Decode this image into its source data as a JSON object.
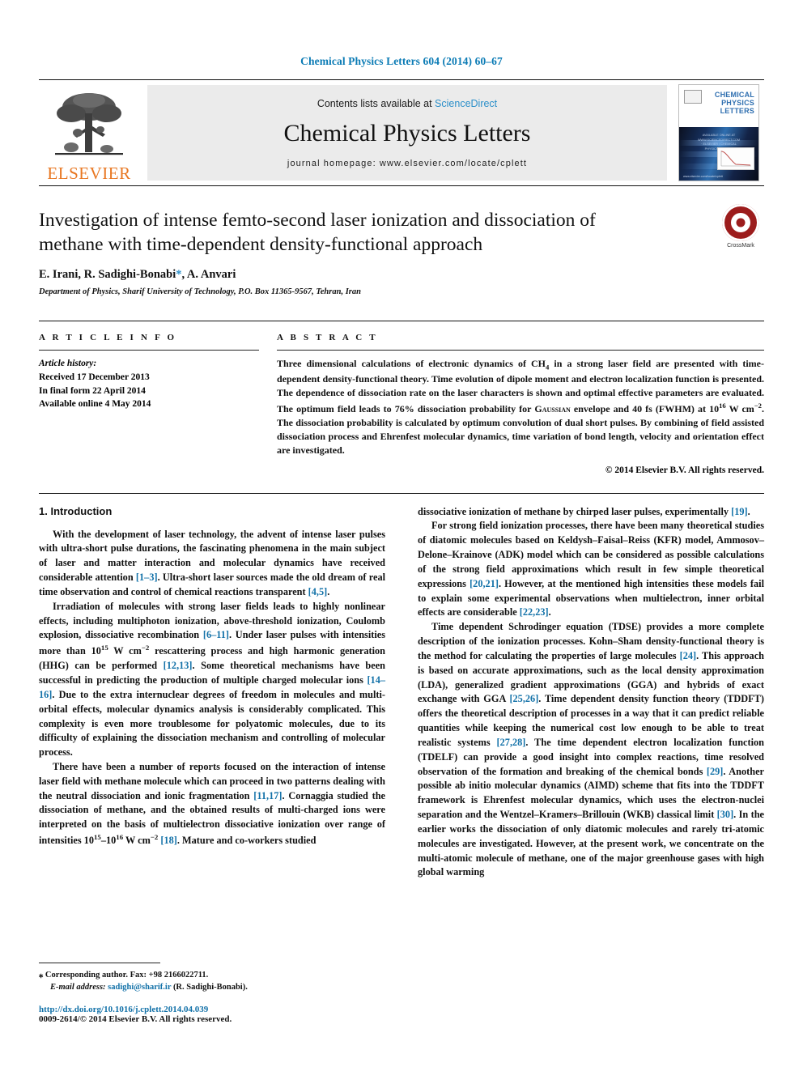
{
  "running_head": "Chemical Physics Letters 604 (2014) 60–67",
  "masthead": {
    "publisher_name": "ELSEVIER",
    "contents_prefix": "Contents lists available at ",
    "contents_link": "ScienceDirect",
    "journal_title": "Chemical Physics Letters",
    "homepage": "journal homepage: www.elsevier.com/locate/cplett",
    "cover": {
      "journal_name_line1": "CHEMICAL",
      "journal_name_line2": "PHYSICS",
      "journal_name_line3": "LETTERS",
      "header_note": "AVAILABLE ONLINE AT WWW.SCIENCEDIRECT.COM\nELSEVIER / CHEMICAL PHYSICS LETTERS",
      "footer_note": "www.elsevier.com/locate/cplett"
    }
  },
  "article": {
    "title": "Investigation of intense femto-second laser ionization and dissociation of methane with time-dependent density-functional approach",
    "authors_part1": "E. Irani, R. Sadighi-Bonabi",
    "authors_star": "*",
    "authors_part2": ", A. Anvari",
    "affiliation": "Department of Physics, Sharif University of Technology, P.O. Box 11365-9567, Tehran, Iran",
    "crossmark_label": "CrossMark"
  },
  "article_info": {
    "heading": "A R T I C L E    I N F O",
    "history_label": "Article history:",
    "history": [
      "Received 17 December 2013",
      "In final form 22 April 2014",
      "Available online 4 May 2014"
    ]
  },
  "abstract": {
    "heading": "A B S T R A C T",
    "segments": [
      {
        "t": "Three dimensional calculations of electronic dynamics of CH"
      },
      {
        "sub": "4"
      },
      {
        "t": " in a strong laser field are presented with time-dependent density-functional theory. Time evolution of dipole moment and electron localization function is presented. The dependence of dissociation rate on the laser characters is shown and optimal effective parameters are evaluated. The optimum field leads to 76% dissociation probability for "
      },
      {
        "smallcaps": "Gaussian"
      },
      {
        "t": " envelope and 40 fs (FWHM) at 10"
      },
      {
        "sup": "16"
      },
      {
        "t": " W cm"
      },
      {
        "sup": "−2"
      },
      {
        "t": ". The dissociation probability is calculated by optimum convolution of dual short pulses. By combining of field assisted dissociation process and Ehrenfest molecular dynamics, time variation of bond length, velocity and orientation effect are investigated."
      }
    ],
    "copyright": "© 2014 Elsevier B.V. All rights reserved."
  },
  "body": {
    "section_heading": "1. Introduction",
    "left_column": [
      [
        {
          "t": "With the development of laser technology, the advent of intense laser pulses with ultra-short pulse durations, the fascinating phenomena in the main subject of laser and matter interaction and molecular dynamics have received considerable attention "
        },
        {
          "ref": "[1–3]"
        },
        {
          "t": ". Ultra-short laser sources made the old dream of real time observation and control of chemical reactions transparent "
        },
        {
          "ref": "[4,5]"
        },
        {
          "t": "."
        }
      ],
      [
        {
          "t": "Irradiation of molecules with strong laser fields leads to highly nonlinear effects, including multiphoton ionization, above-threshold ionization, Coulomb explosion, dissociative recombination "
        },
        {
          "ref": "[6–11]"
        },
        {
          "t": ". Under laser pulses with intensities more than 10"
        },
        {
          "sup": "15"
        },
        {
          "t": " W cm"
        },
        {
          "sup": "−2"
        },
        {
          "t": " rescattering process and high harmonic generation (HHG) can be performed "
        },
        {
          "ref": "[12,13]"
        },
        {
          "t": ". Some theoretical mechanisms have been successful in predicting the production of multiple charged molecular ions "
        },
        {
          "ref": "[14–16]"
        },
        {
          "t": ". Due to the extra internuclear degrees of freedom in molecules and multi-orbital effects, molecular dynamics analysis is considerably complicated. This complexity is even more troublesome for polyatomic molecules, due to its difficulty of explaining the dissociation mechanism and controlling of molecular process."
        }
      ],
      [
        {
          "t": "There have been a number of reports focused on the interaction of intense laser field with methane molecule which can proceed in two patterns dealing with the neutral dissociation and ionic fragmentation "
        },
        {
          "ref": "[11,17]"
        },
        {
          "t": ". Cornaggia studied the dissociation of methane, and the obtained results of multi-charged ions were interpreted on the basis of multielectron dissociative ionization over range of intensities 10"
        },
        {
          "sup": "15"
        },
        {
          "t": "–10"
        },
        {
          "sup": "16"
        },
        {
          "t": " W cm"
        },
        {
          "sup": "−2"
        },
        {
          "t": " "
        },
        {
          "ref": "[18]"
        },
        {
          "t": ". Mature and co-workers studied"
        }
      ]
    ],
    "right_column": [
      [
        {
          "t": "dissociative ionization of methane by chirped laser pulses, experimentally "
        },
        {
          "ref": "[19]"
        },
        {
          "t": "."
        }
      ],
      [
        {
          "t": "For strong field ionization processes, there have been many theoretical studies of diatomic molecules based on Keldysh–Faisal–Reiss (KFR) model, Ammosov–Delone–Krainove (ADK) model which can be considered as possible calculations of the strong field approximations which result in few simple theoretical expressions "
        },
        {
          "ref": "[20,21]"
        },
        {
          "t": ". However, at the mentioned high intensities these models fail to explain some experimental observations when multielectron, inner orbital effects are considerable "
        },
        {
          "ref": "[22,23]"
        },
        {
          "t": "."
        }
      ],
      [
        {
          "t": "Time dependent Schrodinger equation (TDSE) provides a more complete description of the ionization processes. Kohn–Sham density-functional theory is the method for calculating the properties of large molecules "
        },
        {
          "ref": "[24]"
        },
        {
          "t": ". This approach is based on accurate approximations, such as the local density approximation (LDA), generalized gradient approximations (GGA) and hybrids of exact exchange with GGA "
        },
        {
          "ref": "[25,26]"
        },
        {
          "t": ". Time dependent density function theory (TDDFT) offers the theoretical description of processes in a way that it can predict reliable quantities while keeping the numerical cost low enough to be able to treat realistic systems "
        },
        {
          "ref": "[27,28]"
        },
        {
          "t": ". The time dependent electron localization function (TDELF) can provide a good insight into complex reactions, time resolved observation of the formation and breaking of the chemical bonds "
        },
        {
          "ref": "[29]"
        },
        {
          "t": ". Another possible ab initio molecular dynamics (AIMD) scheme that fits into the TDDFT framework is Ehrenfest molecular dynamics, which uses the electron-nuclei separation and the Wentzel–Kramers–Brillouin (WKB) classical limit "
        },
        {
          "ref": "[30]"
        },
        {
          "t": ". In the earlier works the dissociation of only diatomic molecules and rarely tri-atomic molecules are investigated. However, at the present work, we concentrate on the multi-atomic molecule of methane, one of the major greenhouse gases with high global warming"
        }
      ]
    ]
  },
  "footnotes": {
    "corresponding_star": "⁎",
    "corresponding": "Corresponding author. Fax: +98 2166022711.",
    "email_label": "E-mail address:",
    "email": "sadighi@sharif.ir",
    "email_owner": "(R. Sadighi-Bonabi).",
    "doi": "http://dx.doi.org/10.1016/j.cplett.2014.04.039",
    "issn_line": "0009-2614/© 2014 Elsevier B.V. All rights reserved."
  },
  "colors": {
    "link": "#1271a8",
    "running_head": "#0b7bb5",
    "elsevier_orange": "#E87722",
    "crossmark_red": "#9c1c1c"
  }
}
